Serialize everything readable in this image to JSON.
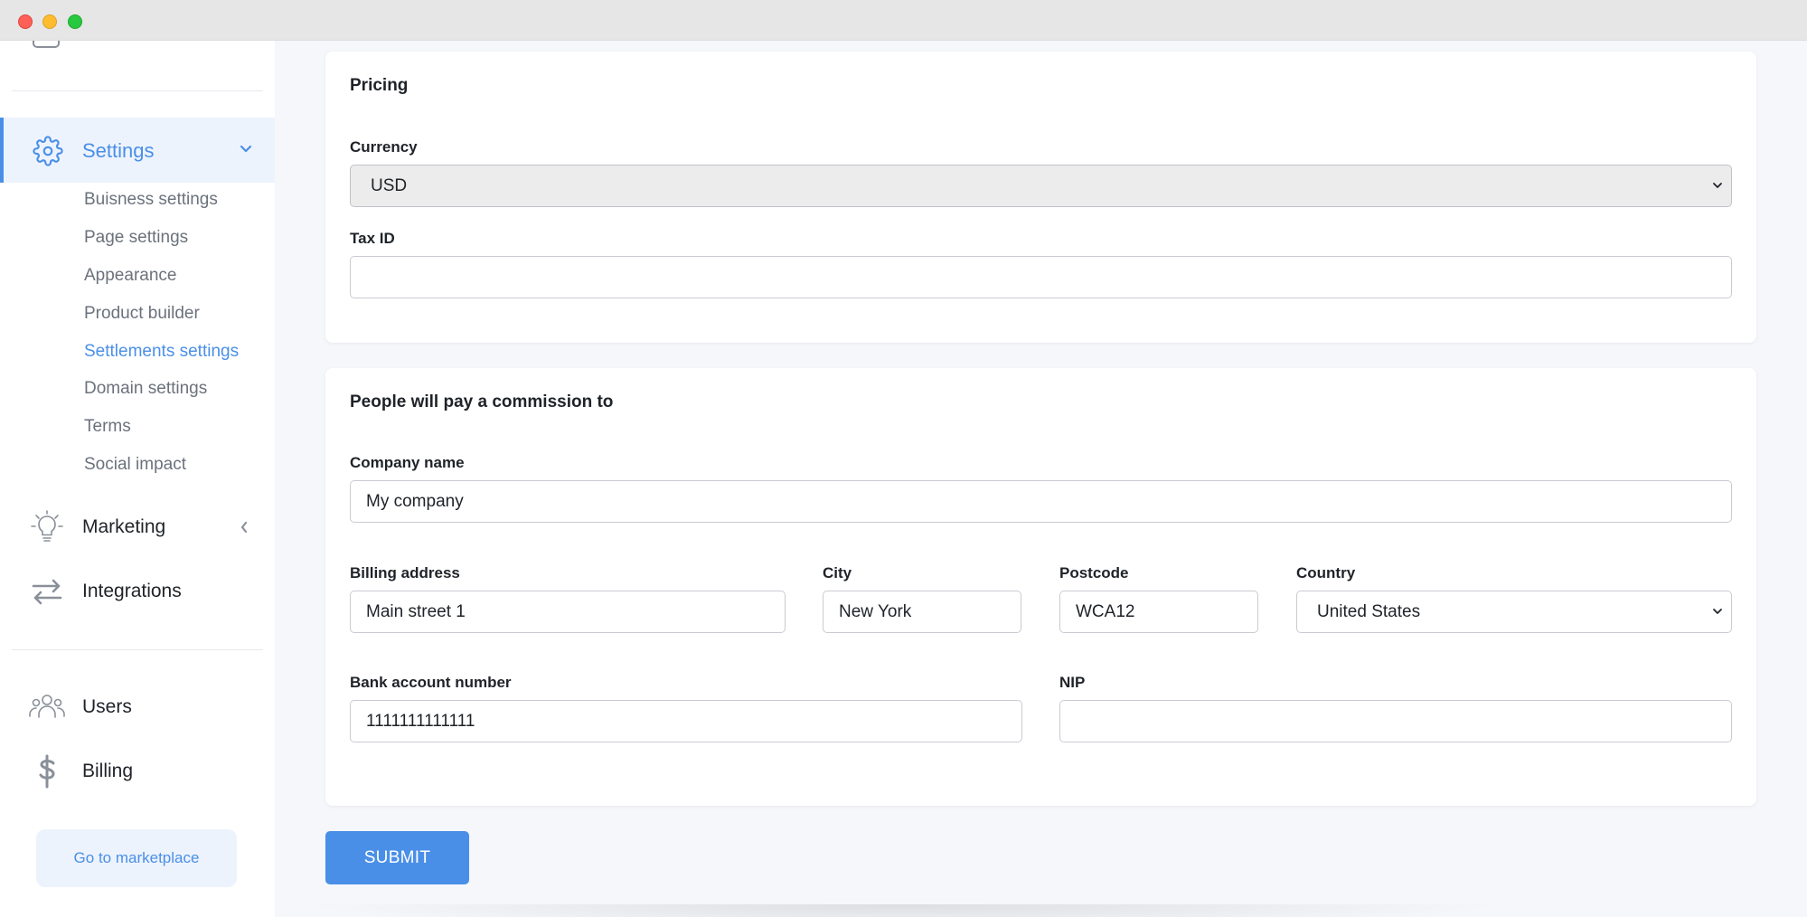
{
  "sidebar": {
    "settings_label": "Settings",
    "sub_items": [
      {
        "label": "Buisness settings",
        "active": false
      },
      {
        "label": "Page settings",
        "active": false
      },
      {
        "label": "Appearance",
        "active": false
      },
      {
        "label": "Product builder",
        "active": false
      },
      {
        "label": "Settlements settings",
        "active": true
      },
      {
        "label": "Domain settings",
        "active": false
      },
      {
        "label": "Terms",
        "active": false
      },
      {
        "label": "Social impact",
        "active": false
      }
    ],
    "marketing_label": "Marketing",
    "integrations_label": "Integrations",
    "users_label": "Users",
    "billing_label": "Billing",
    "marketplace_label": "Go to marketplace",
    "icons": [
      "gear-icon",
      "chevron-down-icon",
      "lightbulb-icon",
      "chevron-left-icon",
      "arrows-exchange-icon",
      "users-icon",
      "dollar-icon"
    ]
  },
  "pricing": {
    "title": "Pricing",
    "currency_label": "Currency",
    "currency_value": "USD",
    "tax_id_label": "Tax ID",
    "tax_id_value": ""
  },
  "commission": {
    "title": "People will pay a commission to",
    "company_name_label": "Company name",
    "company_name_value": "My company",
    "billing_address_label": "Billing address",
    "billing_address_value": "Main street 1",
    "city_label": "City",
    "city_value": "New York",
    "postcode_label": "Postcode",
    "postcode_value": "WCA12",
    "country_label": "Country",
    "country_value": "United States",
    "bank_account_label": "Bank account number",
    "bank_account_value": "1111111111111",
    "nip_label": "NIP",
    "nip_value": ""
  },
  "submit_label": "SUBMIT",
  "colors": {
    "accent": "#4a8fe7",
    "active_bg": "#edf3fd",
    "page_bg": "#f5f7fb"
  }
}
